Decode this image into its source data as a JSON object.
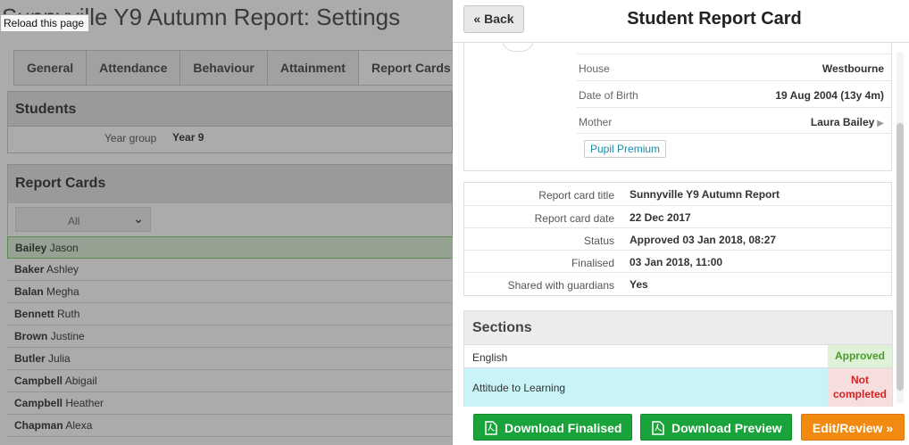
{
  "background_page": {
    "title": "Sunnyville Y9 Autumn Report: Settings",
    "reload_tooltip": "Reload this page",
    "tabs": [
      "General",
      "Attendance",
      "Behaviour",
      "Attainment",
      "Report Cards"
    ],
    "students_heading": "Students",
    "year_group_label": "Year group",
    "year_group_value": "Year 9",
    "report_cards_heading": "Report Cards",
    "filter_value": "All",
    "students": [
      {
        "last": "Bailey",
        "first": "Jason",
        "selected": true
      },
      {
        "last": "Baker",
        "first": "Ashley"
      },
      {
        "last": "Balan",
        "first": "Megha"
      },
      {
        "last": "Bennett",
        "first": "Ruth"
      },
      {
        "last": "Brown",
        "first": "Justine"
      },
      {
        "last": "Butler",
        "first": "Julia"
      },
      {
        "last": "Campbell",
        "first": "Abigail"
      },
      {
        "last": "Campbell",
        "first": "Heather"
      },
      {
        "last": "Chapman",
        "first": "Alexa"
      }
    ]
  },
  "drawer": {
    "back_label": "« Back",
    "title": "Student Report Card",
    "profile": {
      "house_label": "House",
      "house_value": "Westbourne",
      "dob_label": "Date of Birth",
      "dob_value": "19 Aug 2004 (13y 4m)",
      "mother_label": "Mother",
      "mother_value": "Laura Bailey",
      "badge": "Pupil Premium"
    },
    "details": [
      {
        "label": "Report card title",
        "value": "Sunnyville Y9 Autumn Report"
      },
      {
        "label": "Report card date",
        "value": "22 Dec 2017"
      },
      {
        "label": "Status",
        "value": "Approved 03 Jan 2018, 08:27"
      },
      {
        "label": "Finalised",
        "value": "03 Jan 2018, 11:00"
      },
      {
        "label": "Shared with guardians",
        "value": "Yes"
      }
    ],
    "sections_heading": "Sections",
    "sections": [
      {
        "name": "English",
        "status": "Approved"
      },
      {
        "name": "Attitude to Learning",
        "status": "Not completed"
      }
    ],
    "buttons": {
      "download_finalised": "Download Finalised",
      "download_preview": "Download Preview",
      "edit_review": "Edit/Review »"
    }
  },
  "colors": {
    "approved_bg": "#dff2d8",
    "approved_text": "#4a9a2e",
    "not_completed_bg": "#f6dede",
    "not_completed_text": "#d32222",
    "button_green": "#19a33a",
    "button_orange": "#f28a12",
    "highlight_row": "#c9f4f7"
  }
}
